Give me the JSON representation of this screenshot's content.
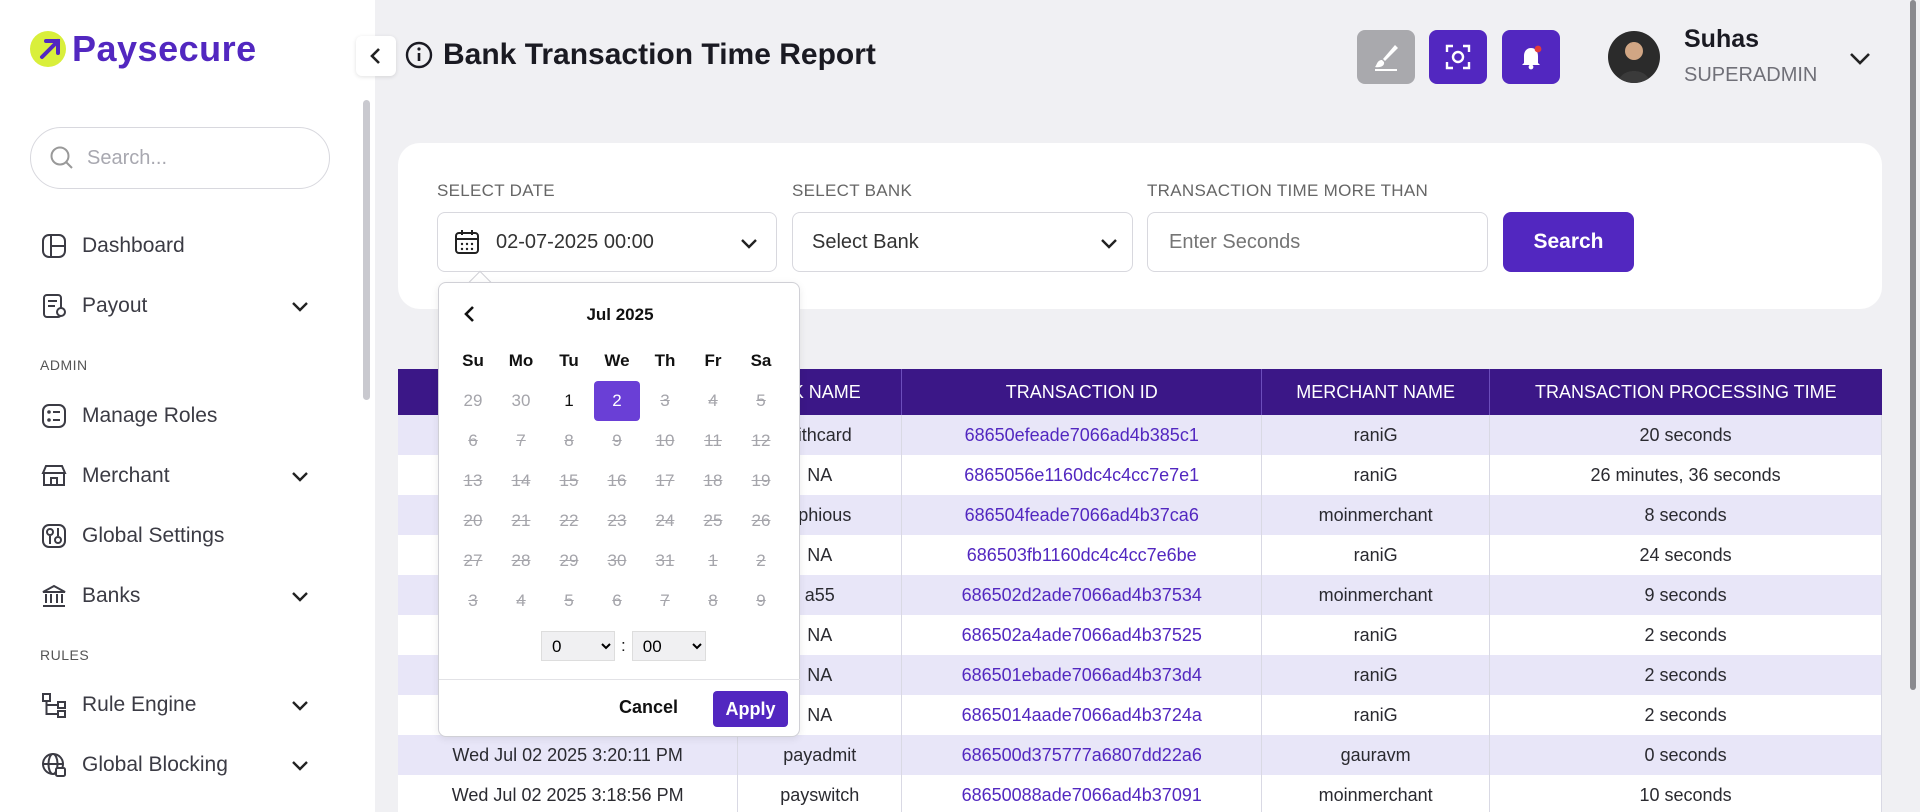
{
  "brand": {
    "name": "Paysecure",
    "accent": "#5227c0",
    "logo_color": "#d9ef3b"
  },
  "sidebar": {
    "search_placeholder": "Search...",
    "items": [
      {
        "label": "Dashboard",
        "icon": "dashboard-icon"
      },
      {
        "label": "Payout",
        "icon": "payout-icon"
      },
      {
        "label": "Manage Roles",
        "icon": "roles-icon"
      },
      {
        "label": "Merchant",
        "icon": "merchant-icon"
      },
      {
        "label": "Global Settings",
        "icon": "settings-icon"
      },
      {
        "label": "Banks",
        "icon": "bank-icon"
      },
      {
        "label": "Rule Engine",
        "icon": "rule-engine-icon"
      },
      {
        "label": "Global Blocking",
        "icon": "global-blocking-icon"
      }
    ],
    "sections": {
      "admin": "ADMIN",
      "rules": "RULES"
    }
  },
  "header": {
    "title": "Bank Transaction Time Report",
    "user": {
      "name": "Suhas",
      "role": "SUPERADMIN"
    }
  },
  "filters": {
    "date_label": "SELECT DATE",
    "date_value": "02-07-2025 00:00",
    "bank_label": "SELECT BANK",
    "bank_value": "Select Bank",
    "time_label": "TRANSACTION TIME MORE THAN",
    "time_placeholder": "Enter Seconds",
    "search_label": "Search"
  },
  "datepicker": {
    "month": "Jul 2025",
    "day_headers": [
      "Su",
      "Mo",
      "Tu",
      "We",
      "Th",
      "Fr",
      "Sa"
    ],
    "days": [
      [
        "29",
        "30",
        "1",
        "2",
        "3",
        "4",
        "5"
      ],
      [
        "6",
        "7",
        "8",
        "9",
        "10",
        "11",
        "12"
      ],
      [
        "13",
        "14",
        "15",
        "16",
        "17",
        "18",
        "19"
      ],
      [
        "20",
        "21",
        "22",
        "23",
        "24",
        "25",
        "26"
      ],
      [
        "27",
        "28",
        "29",
        "30",
        "31",
        "1",
        "2"
      ],
      [
        "3",
        "4",
        "5",
        "6",
        "7",
        "8",
        "9"
      ]
    ],
    "selected_day": "2",
    "hour": "0",
    "minute": "00",
    "cancel_label": "Cancel",
    "apply_label": "Apply"
  },
  "table": {
    "headers": [
      "",
      "BANK NAME",
      "TRANSACTION ID",
      "MERCHANT NAME",
      "TRANSACTION PROCESSING TIME"
    ],
    "header_visible": [
      "",
      "NK NAME",
      "TRANSACTION ID",
      "MERCHANT NAME",
      "TRANSACTION PROCESSING TIME"
    ],
    "rows": [
      [
        "",
        "nithcard",
        "68650efeade7066ad4b385c1",
        "raniG",
        "20 seconds"
      ],
      [
        "",
        "NA",
        "6865056e1160dc4c4cc7e7e1",
        "raniG",
        "26 minutes, 36 seconds"
      ],
      [
        "",
        "ophious",
        "686504feade7066ad4b37ca6",
        "moinmerchant",
        "8 seconds"
      ],
      [
        "",
        "NA",
        "686503fb1160dc4c4cc7e6be",
        "raniG",
        "24 seconds"
      ],
      [
        "",
        "a55",
        "686502d2ade7066ad4b37534",
        "moinmerchant",
        "9 seconds"
      ],
      [
        "",
        "NA",
        "686502a4ade7066ad4b37525",
        "raniG",
        "2 seconds"
      ],
      [
        "",
        "NA",
        "686501ebade7066ad4b373d4",
        "raniG",
        "2 seconds"
      ],
      [
        "",
        "NA",
        "6865014aade7066ad4b3724a",
        "raniG",
        "2 seconds"
      ],
      [
        "Wed Jul 02 2025 3:20:11 PM",
        "payadmit",
        "686500d375777a6807dd22a6",
        "gauravm",
        "0 seconds"
      ],
      [
        "Wed Jul 02 2025 3:18:56 PM",
        "payswitch",
        "68650088ade7066ad4b37091",
        "moinmerchant",
        "10 seconds"
      ]
    ]
  }
}
